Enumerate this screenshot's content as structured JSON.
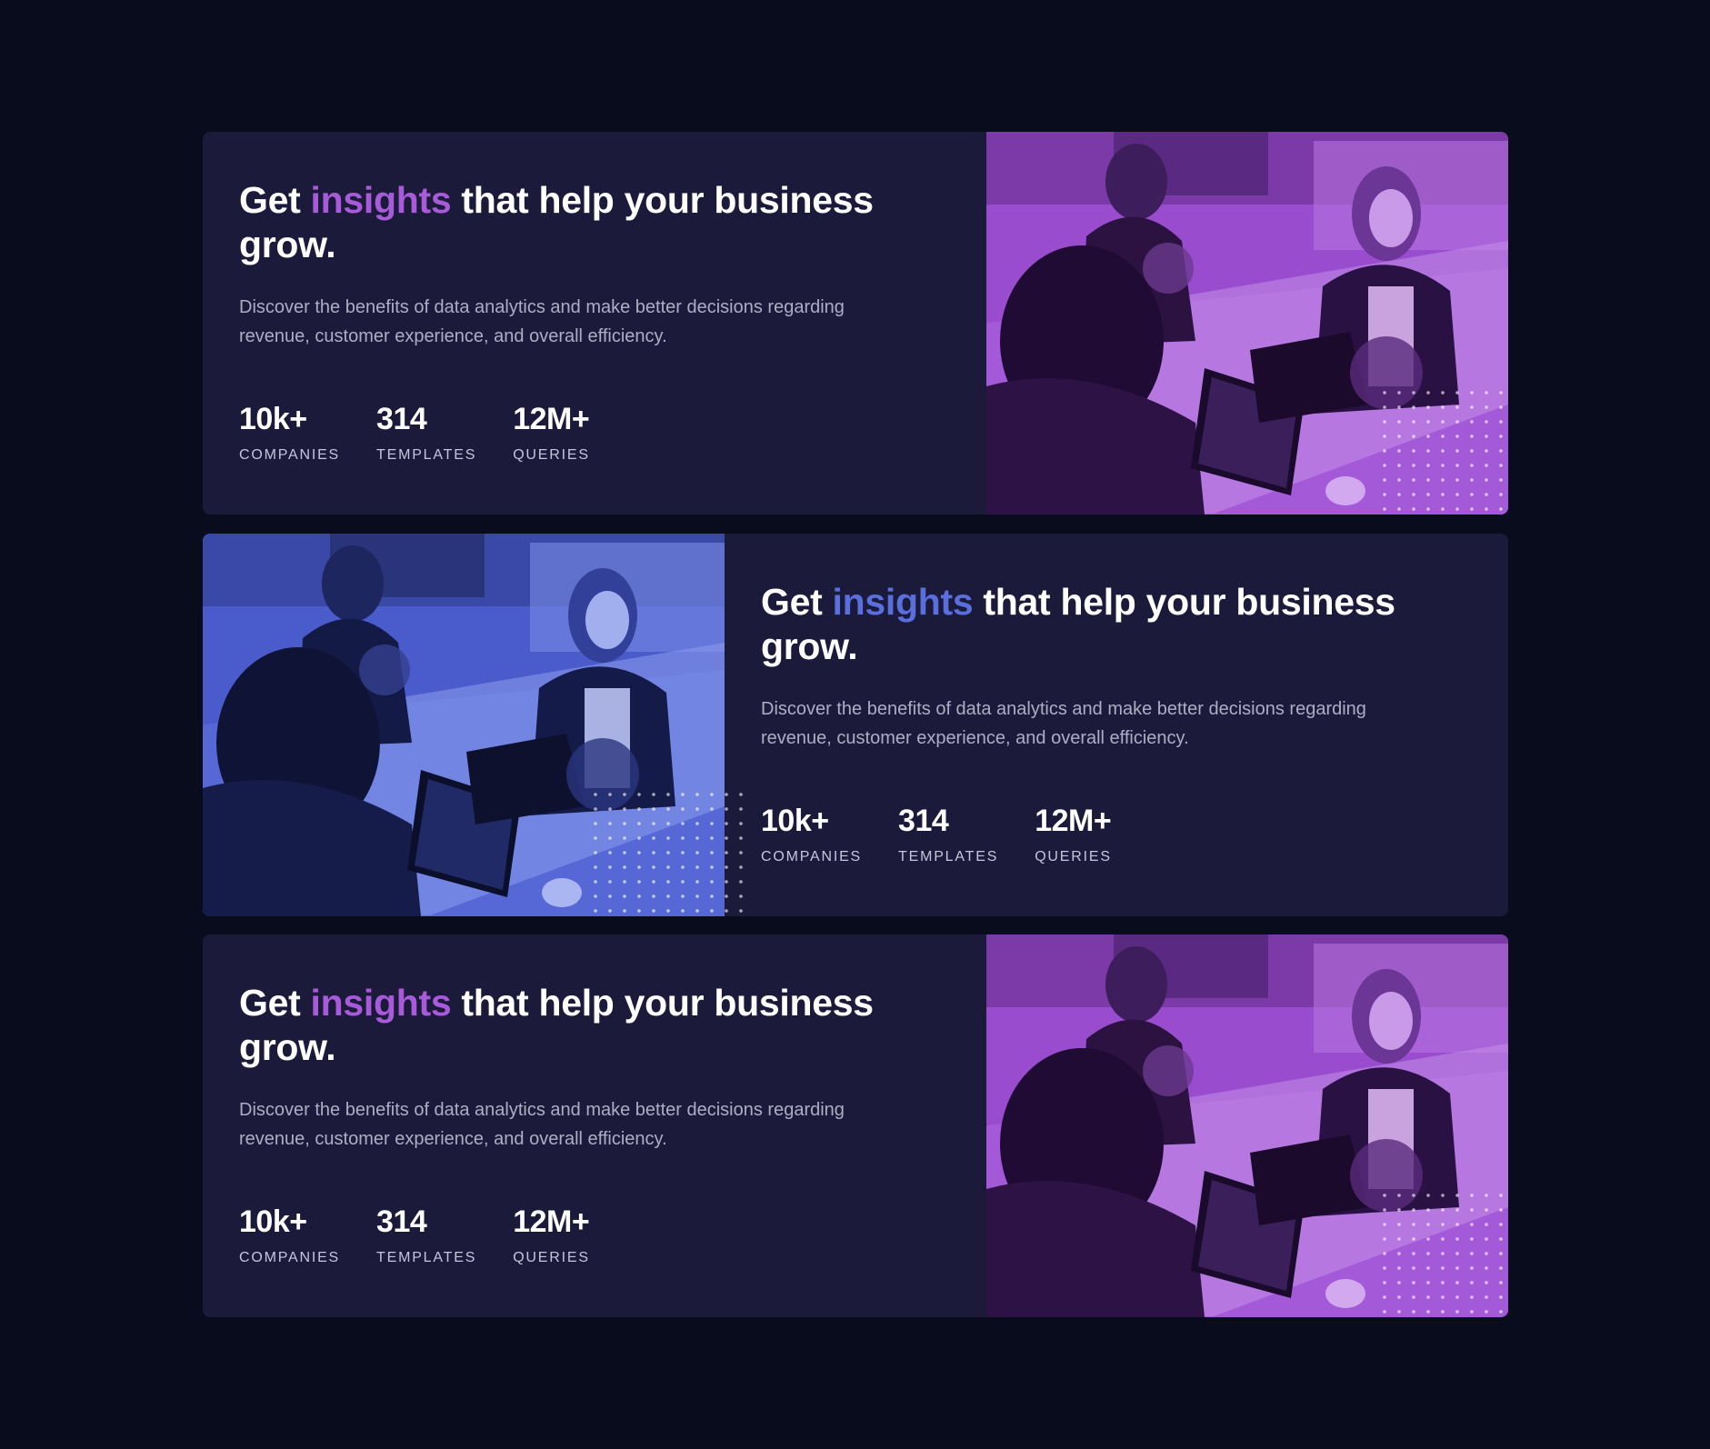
{
  "theme": {
    "background": "#090c1c",
    "card_background": "#1c1a3a",
    "purple_accent": "#a75bd8",
    "blue_accent": "#5a6fdc",
    "purple_photo_tint": "#a44fdb",
    "blue_photo_tint": "#4c5ed0"
  },
  "cards": [
    {
      "variant": "purple",
      "headline": {
        "before": "Get ",
        "accent": "insights",
        "after": " that help your business grow."
      },
      "description": "Discover the benefits of data analytics and make better decisions regarding revenue, customer experience, and overall efficiency.",
      "stats": [
        {
          "value": "10k+",
          "label": "COMPANIES"
        },
        {
          "value": "314",
          "label": "TEMPLATES"
        },
        {
          "value": "12M+",
          "label": "QUERIES"
        }
      ],
      "image_alt": "office-photo-purple"
    },
    {
      "variant": "blue",
      "headline": {
        "before": "Get ",
        "accent": "insights",
        "after": " that help your business grow."
      },
      "description": "Discover the benefits of data analytics and make better decisions regarding revenue, customer experience, and overall efficiency.",
      "stats": [
        {
          "value": "10k+",
          "label": "COMPANIES"
        },
        {
          "value": "314",
          "label": "TEMPLATES"
        },
        {
          "value": "12M+",
          "label": "QUERIES"
        }
      ],
      "image_alt": "office-photo-blue"
    },
    {
      "variant": "purple",
      "headline": {
        "before": "Get ",
        "accent": "insights",
        "after": " that help your business grow."
      },
      "description": "Discover the benefits of data analytics and make better decisions regarding revenue, customer experience, and overall efficiency.",
      "stats": [
        {
          "value": "10k+",
          "label": "COMPANIES"
        },
        {
          "value": "314",
          "label": "TEMPLATES"
        },
        {
          "value": "12M+",
          "label": "QUERIES"
        }
      ],
      "image_alt": "office-photo-purple"
    }
  ]
}
